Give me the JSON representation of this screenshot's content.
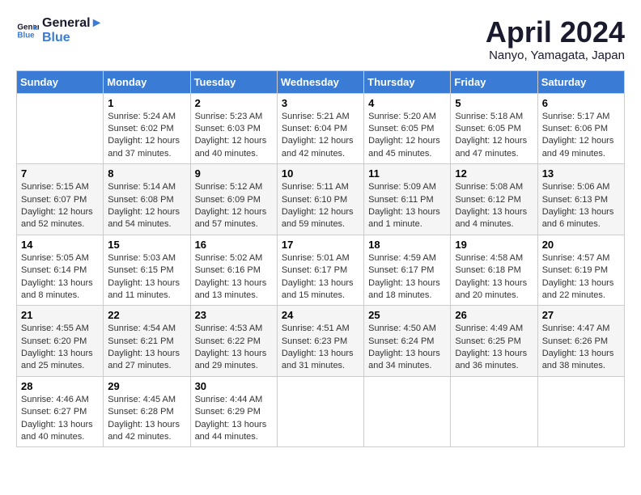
{
  "header": {
    "logo_line1": "General",
    "logo_line2": "Blue",
    "month_title": "April 2024",
    "subtitle": "Nanyo, Yamagata, Japan"
  },
  "days_of_week": [
    "Sunday",
    "Monday",
    "Tuesday",
    "Wednesday",
    "Thursday",
    "Friday",
    "Saturday"
  ],
  "weeks": [
    [
      {
        "day": "",
        "info": ""
      },
      {
        "day": "1",
        "info": "Sunrise: 5:24 AM\nSunset: 6:02 PM\nDaylight: 12 hours\nand 37 minutes."
      },
      {
        "day": "2",
        "info": "Sunrise: 5:23 AM\nSunset: 6:03 PM\nDaylight: 12 hours\nand 40 minutes."
      },
      {
        "day": "3",
        "info": "Sunrise: 5:21 AM\nSunset: 6:04 PM\nDaylight: 12 hours\nand 42 minutes."
      },
      {
        "day": "4",
        "info": "Sunrise: 5:20 AM\nSunset: 6:05 PM\nDaylight: 12 hours\nand 45 minutes."
      },
      {
        "day": "5",
        "info": "Sunrise: 5:18 AM\nSunset: 6:05 PM\nDaylight: 12 hours\nand 47 minutes."
      },
      {
        "day": "6",
        "info": "Sunrise: 5:17 AM\nSunset: 6:06 PM\nDaylight: 12 hours\nand 49 minutes."
      }
    ],
    [
      {
        "day": "7",
        "info": "Sunrise: 5:15 AM\nSunset: 6:07 PM\nDaylight: 12 hours\nand 52 minutes."
      },
      {
        "day": "8",
        "info": "Sunrise: 5:14 AM\nSunset: 6:08 PM\nDaylight: 12 hours\nand 54 minutes."
      },
      {
        "day": "9",
        "info": "Sunrise: 5:12 AM\nSunset: 6:09 PM\nDaylight: 12 hours\nand 57 minutes."
      },
      {
        "day": "10",
        "info": "Sunrise: 5:11 AM\nSunset: 6:10 PM\nDaylight: 12 hours\nand 59 minutes."
      },
      {
        "day": "11",
        "info": "Sunrise: 5:09 AM\nSunset: 6:11 PM\nDaylight: 13 hours\nand 1 minute."
      },
      {
        "day": "12",
        "info": "Sunrise: 5:08 AM\nSunset: 6:12 PM\nDaylight: 13 hours\nand 4 minutes."
      },
      {
        "day": "13",
        "info": "Sunrise: 5:06 AM\nSunset: 6:13 PM\nDaylight: 13 hours\nand 6 minutes."
      }
    ],
    [
      {
        "day": "14",
        "info": "Sunrise: 5:05 AM\nSunset: 6:14 PM\nDaylight: 13 hours\nand 8 minutes."
      },
      {
        "day": "15",
        "info": "Sunrise: 5:03 AM\nSunset: 6:15 PM\nDaylight: 13 hours\nand 11 minutes."
      },
      {
        "day": "16",
        "info": "Sunrise: 5:02 AM\nSunset: 6:16 PM\nDaylight: 13 hours\nand 13 minutes."
      },
      {
        "day": "17",
        "info": "Sunrise: 5:01 AM\nSunset: 6:17 PM\nDaylight: 13 hours\nand 15 minutes."
      },
      {
        "day": "18",
        "info": "Sunrise: 4:59 AM\nSunset: 6:17 PM\nDaylight: 13 hours\nand 18 minutes."
      },
      {
        "day": "19",
        "info": "Sunrise: 4:58 AM\nSunset: 6:18 PM\nDaylight: 13 hours\nand 20 minutes."
      },
      {
        "day": "20",
        "info": "Sunrise: 4:57 AM\nSunset: 6:19 PM\nDaylight: 13 hours\nand 22 minutes."
      }
    ],
    [
      {
        "day": "21",
        "info": "Sunrise: 4:55 AM\nSunset: 6:20 PM\nDaylight: 13 hours\nand 25 minutes."
      },
      {
        "day": "22",
        "info": "Sunrise: 4:54 AM\nSunset: 6:21 PM\nDaylight: 13 hours\nand 27 minutes."
      },
      {
        "day": "23",
        "info": "Sunrise: 4:53 AM\nSunset: 6:22 PM\nDaylight: 13 hours\nand 29 minutes."
      },
      {
        "day": "24",
        "info": "Sunrise: 4:51 AM\nSunset: 6:23 PM\nDaylight: 13 hours\nand 31 minutes."
      },
      {
        "day": "25",
        "info": "Sunrise: 4:50 AM\nSunset: 6:24 PM\nDaylight: 13 hours\nand 34 minutes."
      },
      {
        "day": "26",
        "info": "Sunrise: 4:49 AM\nSunset: 6:25 PM\nDaylight: 13 hours\nand 36 minutes."
      },
      {
        "day": "27",
        "info": "Sunrise: 4:47 AM\nSunset: 6:26 PM\nDaylight: 13 hours\nand 38 minutes."
      }
    ],
    [
      {
        "day": "28",
        "info": "Sunrise: 4:46 AM\nSunset: 6:27 PM\nDaylight: 13 hours\nand 40 minutes."
      },
      {
        "day": "29",
        "info": "Sunrise: 4:45 AM\nSunset: 6:28 PM\nDaylight: 13 hours\nand 42 minutes."
      },
      {
        "day": "30",
        "info": "Sunrise: 4:44 AM\nSunset: 6:29 PM\nDaylight: 13 hours\nand 44 minutes."
      },
      {
        "day": "",
        "info": ""
      },
      {
        "day": "",
        "info": ""
      },
      {
        "day": "",
        "info": ""
      },
      {
        "day": "",
        "info": ""
      }
    ]
  ]
}
